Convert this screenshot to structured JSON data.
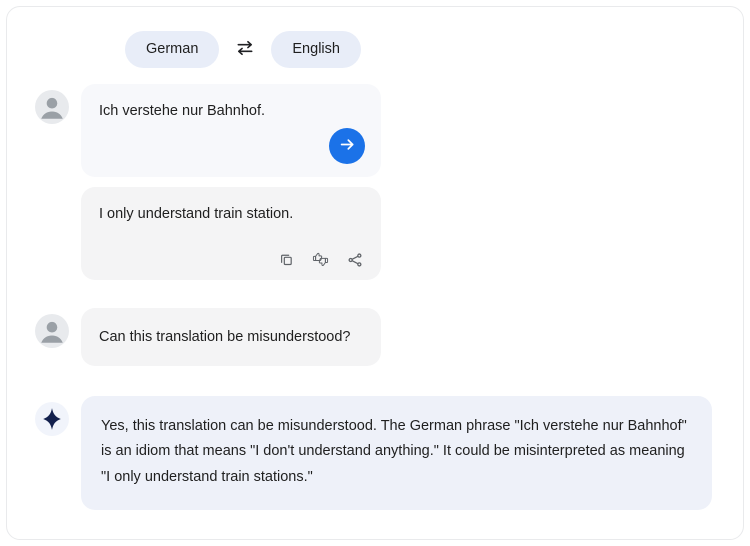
{
  "language_bar": {
    "source_language": "German",
    "target_language": "English",
    "swap_icon": "swap-horizontal-icon"
  },
  "conversation": {
    "translation_turn": {
      "avatar_icon": "user-avatar-icon",
      "source_text": "Ich verstehe nur Bahnhof.",
      "send_icon": "arrow-right-icon",
      "translated_text": "I only understand train station.",
      "actions": [
        {
          "name": "copy-icon",
          "label": "Copy"
        },
        {
          "name": "feedback-thumbs-icon",
          "label": "Rate this translation"
        },
        {
          "name": "share-icon",
          "label": "Share"
        }
      ]
    },
    "question_turn": {
      "avatar_icon": "user-avatar-icon",
      "text": "Can this translation be misunderstood?"
    },
    "answer_turn": {
      "avatar_icon": "sparkle-icon",
      "text": "Yes, this translation can be misunderstood. The German phrase \"Ich verstehe nur Bahnhof\" is an idiom that means \"I don't understand anything.\" It could be misinterpreted as meaning \"I only understand train stations.\""
    }
  },
  "colors": {
    "accent_blue": "#1b72e8",
    "pill_background": "#e8edf8",
    "user_bubble": "#f4f4f5",
    "source_bubble": "#f7f8fb",
    "ai_bubble": "#eef1f9",
    "sparkle": "#13204d"
  }
}
